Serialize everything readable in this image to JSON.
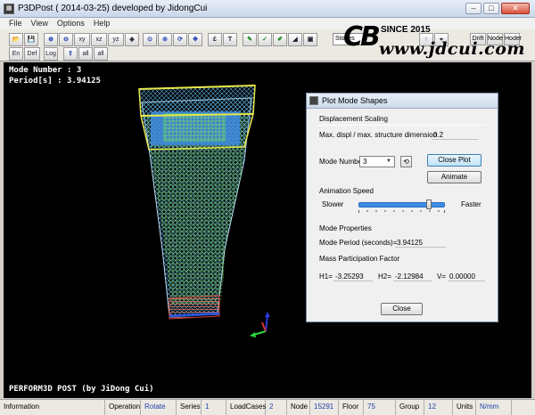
{
  "window": {
    "title": "P3DPost ( 2014-03-25)  developed by JidongCui",
    "icon": "app-icon"
  },
  "menu": [
    "File",
    "View",
    "Options",
    "Help"
  ],
  "toolbar": {
    "row1": [
      "xy",
      "xz",
      "yz"
    ],
    "row2": [
      "En",
      "Def",
      "Log",
      "all",
      "all"
    ],
    "stories_label": "Stories",
    "right_buttons": [
      "Drift",
      "Node",
      "Hoder"
    ]
  },
  "logo": {
    "mark": "CB",
    "since": "SINCE 2015",
    "site": "www.jdcui.com"
  },
  "viewport": {
    "mode_line1": "Mode Number : 3",
    "mode_line2": "Period[s] : 3.94125",
    "footer": "PERFORM3D POST (by JiDong Cui)",
    "colors": {
      "background": "#000000",
      "mesh_yellow": "#e8e84a",
      "mesh_green": "#7ed07a",
      "mesh_blue": "#2a55d8",
      "mesh_red": "#d04030"
    }
  },
  "dialog": {
    "title": "Plot Mode Shapes",
    "displacement_scaling": "Displacement Scaling",
    "max_displ_label": "Max. displ / max. structure dimension",
    "max_displ_value": "0.2",
    "mode_number_label": "Mode Number",
    "mode_number_value": "3",
    "close_plot": "Close Plot",
    "animate": "Animate",
    "animation_speed": "Animation Speed",
    "slower": "Slower",
    "faster": "Faster",
    "animation_speed_fraction": 0.8,
    "mode_properties": "Mode Properties",
    "mode_period_label": "Mode Period (seconds)=",
    "mode_period_value": "3.94125",
    "mass_participation": "Mass Participation Factor",
    "h1_label": "H1=",
    "h1_value": "-3.25293",
    "h2_label": "H2=",
    "h2_value": "-2.12984",
    "v_label": "V=",
    "v_value": "0.00000",
    "close": "Close"
  },
  "status": [
    {
      "label": "Information",
      "value": ""
    },
    {
      "label": "Operation",
      "value": "Rotate"
    },
    {
      "label": "Series",
      "value": "1"
    },
    {
      "label": "LoadCases",
      "value": "2"
    },
    {
      "label": "Node",
      "value": "15291"
    },
    {
      "label": "Floor",
      "value": "75"
    },
    {
      "label": "Group",
      "value": "12"
    },
    {
      "label": "Units",
      "value": "N/mm"
    }
  ]
}
